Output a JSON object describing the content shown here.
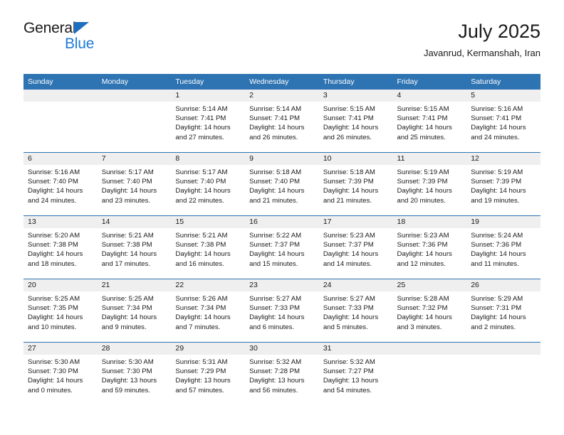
{
  "brand": {
    "name_part1": "General",
    "name_part2": "Blue",
    "triangle_icon": "triangle-icon",
    "accent_color": "#1f7ad6"
  },
  "header": {
    "title": "July 2025",
    "subtitle": "Javanrud, Kermanshah, Iran"
  },
  "theme": {
    "header_blue": "#2e73b2",
    "daynum_band": "#efefef",
    "text": "#1a1a1a"
  },
  "weekday_headers": [
    "Sunday",
    "Monday",
    "Tuesday",
    "Wednesday",
    "Thursday",
    "Friday",
    "Saturday"
  ],
  "weeks": [
    [
      {
        "day": "",
        "sunrise": "",
        "sunset": "",
        "daylight_line1": "",
        "daylight_line2": ""
      },
      {
        "day": "",
        "sunrise": "",
        "sunset": "",
        "daylight_line1": "",
        "daylight_line2": ""
      },
      {
        "day": "1",
        "sunrise": "Sunrise: 5:14 AM",
        "sunset": "Sunset: 7:41 PM",
        "daylight_line1": "Daylight: 14 hours",
        "daylight_line2": "and 27 minutes."
      },
      {
        "day": "2",
        "sunrise": "Sunrise: 5:14 AM",
        "sunset": "Sunset: 7:41 PM",
        "daylight_line1": "Daylight: 14 hours",
        "daylight_line2": "and 26 minutes."
      },
      {
        "day": "3",
        "sunrise": "Sunrise: 5:15 AM",
        "sunset": "Sunset: 7:41 PM",
        "daylight_line1": "Daylight: 14 hours",
        "daylight_line2": "and 26 minutes."
      },
      {
        "day": "4",
        "sunrise": "Sunrise: 5:15 AM",
        "sunset": "Sunset: 7:41 PM",
        "daylight_line1": "Daylight: 14 hours",
        "daylight_line2": "and 25 minutes."
      },
      {
        "day": "5",
        "sunrise": "Sunrise: 5:16 AM",
        "sunset": "Sunset: 7:41 PM",
        "daylight_line1": "Daylight: 14 hours",
        "daylight_line2": "and 24 minutes."
      }
    ],
    [
      {
        "day": "6",
        "sunrise": "Sunrise: 5:16 AM",
        "sunset": "Sunset: 7:40 PM",
        "daylight_line1": "Daylight: 14 hours",
        "daylight_line2": "and 24 minutes."
      },
      {
        "day": "7",
        "sunrise": "Sunrise: 5:17 AM",
        "sunset": "Sunset: 7:40 PM",
        "daylight_line1": "Daylight: 14 hours",
        "daylight_line2": "and 23 minutes."
      },
      {
        "day": "8",
        "sunrise": "Sunrise: 5:17 AM",
        "sunset": "Sunset: 7:40 PM",
        "daylight_line1": "Daylight: 14 hours",
        "daylight_line2": "and 22 minutes."
      },
      {
        "day": "9",
        "sunrise": "Sunrise: 5:18 AM",
        "sunset": "Sunset: 7:40 PM",
        "daylight_line1": "Daylight: 14 hours",
        "daylight_line2": "and 21 minutes."
      },
      {
        "day": "10",
        "sunrise": "Sunrise: 5:18 AM",
        "sunset": "Sunset: 7:39 PM",
        "daylight_line1": "Daylight: 14 hours",
        "daylight_line2": "and 21 minutes."
      },
      {
        "day": "11",
        "sunrise": "Sunrise: 5:19 AM",
        "sunset": "Sunset: 7:39 PM",
        "daylight_line1": "Daylight: 14 hours",
        "daylight_line2": "and 20 minutes."
      },
      {
        "day": "12",
        "sunrise": "Sunrise: 5:19 AM",
        "sunset": "Sunset: 7:39 PM",
        "daylight_line1": "Daylight: 14 hours",
        "daylight_line2": "and 19 minutes."
      }
    ],
    [
      {
        "day": "13",
        "sunrise": "Sunrise: 5:20 AM",
        "sunset": "Sunset: 7:38 PM",
        "daylight_line1": "Daylight: 14 hours",
        "daylight_line2": "and 18 minutes."
      },
      {
        "day": "14",
        "sunrise": "Sunrise: 5:21 AM",
        "sunset": "Sunset: 7:38 PM",
        "daylight_line1": "Daylight: 14 hours",
        "daylight_line2": "and 17 minutes."
      },
      {
        "day": "15",
        "sunrise": "Sunrise: 5:21 AM",
        "sunset": "Sunset: 7:38 PM",
        "daylight_line1": "Daylight: 14 hours",
        "daylight_line2": "and 16 minutes."
      },
      {
        "day": "16",
        "sunrise": "Sunrise: 5:22 AM",
        "sunset": "Sunset: 7:37 PM",
        "daylight_line1": "Daylight: 14 hours",
        "daylight_line2": "and 15 minutes."
      },
      {
        "day": "17",
        "sunrise": "Sunrise: 5:23 AM",
        "sunset": "Sunset: 7:37 PM",
        "daylight_line1": "Daylight: 14 hours",
        "daylight_line2": "and 14 minutes."
      },
      {
        "day": "18",
        "sunrise": "Sunrise: 5:23 AM",
        "sunset": "Sunset: 7:36 PM",
        "daylight_line1": "Daylight: 14 hours",
        "daylight_line2": "and 12 minutes."
      },
      {
        "day": "19",
        "sunrise": "Sunrise: 5:24 AM",
        "sunset": "Sunset: 7:36 PM",
        "daylight_line1": "Daylight: 14 hours",
        "daylight_line2": "and 11 minutes."
      }
    ],
    [
      {
        "day": "20",
        "sunrise": "Sunrise: 5:25 AM",
        "sunset": "Sunset: 7:35 PM",
        "daylight_line1": "Daylight: 14 hours",
        "daylight_line2": "and 10 minutes."
      },
      {
        "day": "21",
        "sunrise": "Sunrise: 5:25 AM",
        "sunset": "Sunset: 7:34 PM",
        "daylight_line1": "Daylight: 14 hours",
        "daylight_line2": "and 9 minutes."
      },
      {
        "day": "22",
        "sunrise": "Sunrise: 5:26 AM",
        "sunset": "Sunset: 7:34 PM",
        "daylight_line1": "Daylight: 14 hours",
        "daylight_line2": "and 7 minutes."
      },
      {
        "day": "23",
        "sunrise": "Sunrise: 5:27 AM",
        "sunset": "Sunset: 7:33 PM",
        "daylight_line1": "Daylight: 14 hours",
        "daylight_line2": "and 6 minutes."
      },
      {
        "day": "24",
        "sunrise": "Sunrise: 5:27 AM",
        "sunset": "Sunset: 7:33 PM",
        "daylight_line1": "Daylight: 14 hours",
        "daylight_line2": "and 5 minutes."
      },
      {
        "day": "25",
        "sunrise": "Sunrise: 5:28 AM",
        "sunset": "Sunset: 7:32 PM",
        "daylight_line1": "Daylight: 14 hours",
        "daylight_line2": "and 3 minutes."
      },
      {
        "day": "26",
        "sunrise": "Sunrise: 5:29 AM",
        "sunset": "Sunset: 7:31 PM",
        "daylight_line1": "Daylight: 14 hours",
        "daylight_line2": "and 2 minutes."
      }
    ],
    [
      {
        "day": "27",
        "sunrise": "Sunrise: 5:30 AM",
        "sunset": "Sunset: 7:30 PM",
        "daylight_line1": "Daylight: 14 hours",
        "daylight_line2": "and 0 minutes."
      },
      {
        "day": "28",
        "sunrise": "Sunrise: 5:30 AM",
        "sunset": "Sunset: 7:30 PM",
        "daylight_line1": "Daylight: 13 hours",
        "daylight_line2": "and 59 minutes."
      },
      {
        "day": "29",
        "sunrise": "Sunrise: 5:31 AM",
        "sunset": "Sunset: 7:29 PM",
        "daylight_line1": "Daylight: 13 hours",
        "daylight_line2": "and 57 minutes."
      },
      {
        "day": "30",
        "sunrise": "Sunrise: 5:32 AM",
        "sunset": "Sunset: 7:28 PM",
        "daylight_line1": "Daylight: 13 hours",
        "daylight_line2": "and 56 minutes."
      },
      {
        "day": "31",
        "sunrise": "Sunrise: 5:32 AM",
        "sunset": "Sunset: 7:27 PM",
        "daylight_line1": "Daylight: 13 hours",
        "daylight_line2": "and 54 minutes."
      },
      {
        "day": "",
        "sunrise": "",
        "sunset": "",
        "daylight_line1": "",
        "daylight_line2": ""
      },
      {
        "day": "",
        "sunrise": "",
        "sunset": "",
        "daylight_line1": "",
        "daylight_line2": ""
      }
    ]
  ]
}
